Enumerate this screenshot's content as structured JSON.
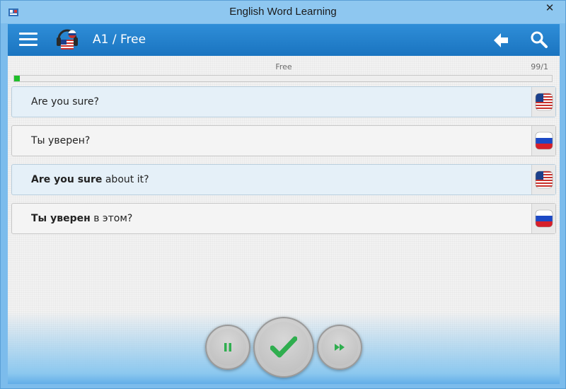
{
  "window": {
    "title": "English Word Learning",
    "close_label": "✕"
  },
  "header": {
    "title": "A1 / Free",
    "icons": {
      "menu": "hamburger-menu-icon",
      "logo": "app-logo-icon",
      "back": "back-arrow-icon",
      "search": "search-icon"
    }
  },
  "progress": {
    "label": "Free",
    "count": "99/1",
    "fraction": 0.01,
    "color": "#1fbf2a"
  },
  "cards": [
    {
      "lang": "en",
      "flag": "us-flag-icon",
      "bold": "",
      "text": "Are you sure?"
    },
    {
      "lang": "ru",
      "flag": "russia-flag-icon",
      "bold": "",
      "text": "Ты уверен?"
    },
    {
      "lang": "en",
      "flag": "us-flag-icon",
      "bold": "Are you sure",
      "text": " about it?"
    },
    {
      "lang": "ru",
      "flag": "russia-flag-icon",
      "bold": "Ты уверен",
      "text": " в этом?"
    }
  ],
  "controls": {
    "pause": "pause-icon",
    "confirm": "checkmark-icon",
    "next": "fast-forward-icon",
    "accent": "#2fae4f"
  },
  "colors": {
    "header": "#1f7dcb",
    "frame": "#8ec7f0"
  }
}
